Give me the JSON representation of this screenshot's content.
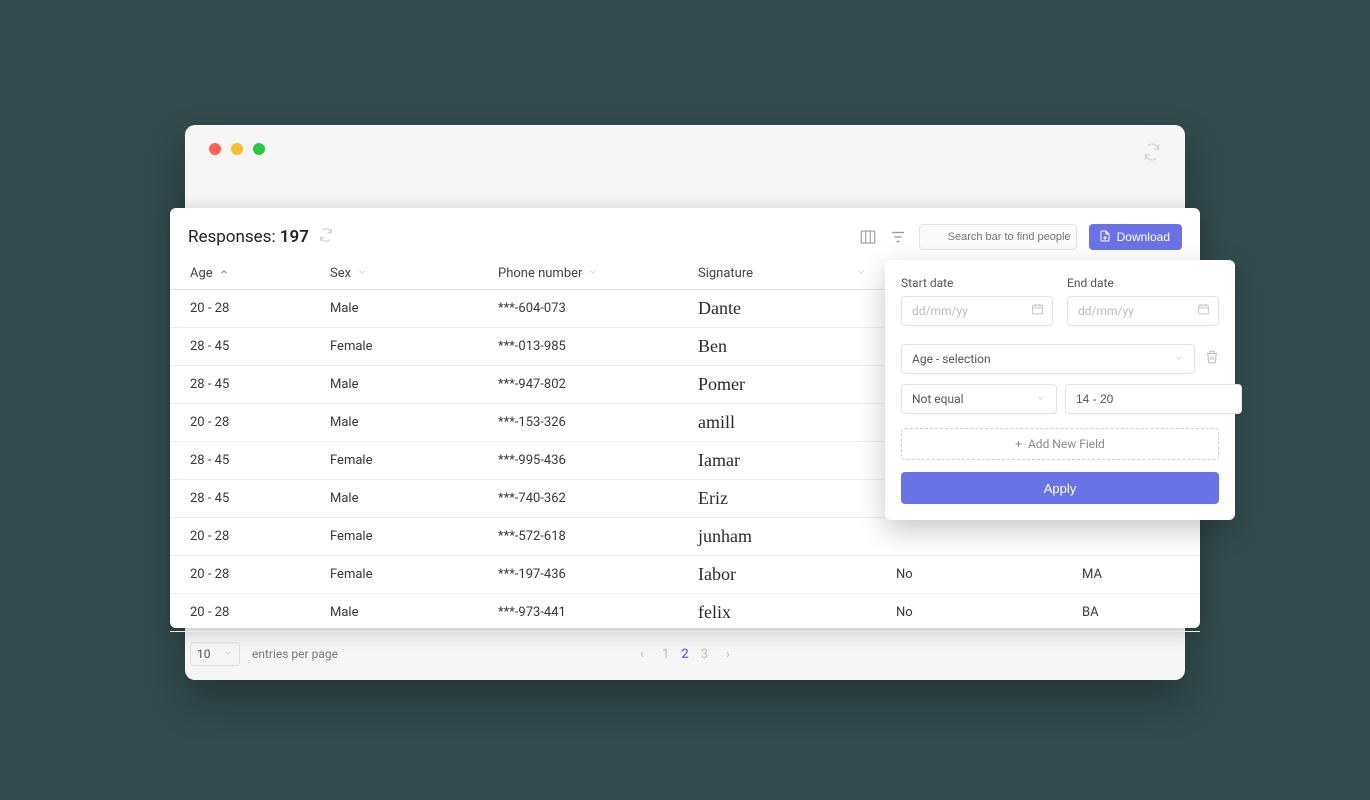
{
  "header": {
    "title_prefix": "Responses: ",
    "count": "197",
    "search_placeholder": "Search bar to find people",
    "download_label": "Download"
  },
  "columns": {
    "age": "Age",
    "sex": "Sex",
    "phone": "Phone number",
    "signature": "Signature",
    "extra1": "",
    "extra2": ""
  },
  "rows": [
    {
      "age": "20 - 28",
      "sex": "Male",
      "phone": "***-604-073",
      "signature": "Dante",
      "col5": "",
      "col6": ""
    },
    {
      "age": "28 - 45",
      "sex": "Female",
      "phone": "***-013-985",
      "signature": "Ben",
      "col5": "",
      "col6": ""
    },
    {
      "age": "28 - 45",
      "sex": "Male",
      "phone": "***-947-802",
      "signature": "Pomer",
      "col5": "",
      "col6": ""
    },
    {
      "age": "20 - 28",
      "sex": "Male",
      "phone": "***-153-326",
      "signature": "amill",
      "col5": "",
      "col6": ""
    },
    {
      "age": "28 - 45",
      "sex": "Female",
      "phone": "***-995-436",
      "signature": "Iamar",
      "col5": "",
      "col6": ""
    },
    {
      "age": "28 - 45",
      "sex": "Male",
      "phone": "***-740-362",
      "signature": "Eriz",
      "col5": "",
      "col6": ""
    },
    {
      "age": "20 - 28",
      "sex": "Female",
      "phone": "***-572-618",
      "signature": "junham",
      "col5": "",
      "col6": ""
    },
    {
      "age": "20 - 28",
      "sex": "Female",
      "phone": "***-197-436",
      "signature": "Iabor",
      "col5": "No",
      "col6": "MA"
    },
    {
      "age": "20 - 28",
      "sex": "Male",
      "phone": "***-973-441",
      "signature": "felix",
      "col5": "No",
      "col6": "BA"
    }
  ],
  "footer": {
    "page_size": "10",
    "per_page_label": "entries per page",
    "pages": [
      "1",
      "2",
      "3"
    ],
    "active_page": "2"
  },
  "filter": {
    "start_label": "Start date",
    "end_label": "End date",
    "date_placeholder": "dd/mm/yy",
    "field_select": "Age - selection",
    "operator": "Not equal",
    "value": "14 - 20",
    "add_label": "Add New Field",
    "apply_label": "Apply"
  }
}
